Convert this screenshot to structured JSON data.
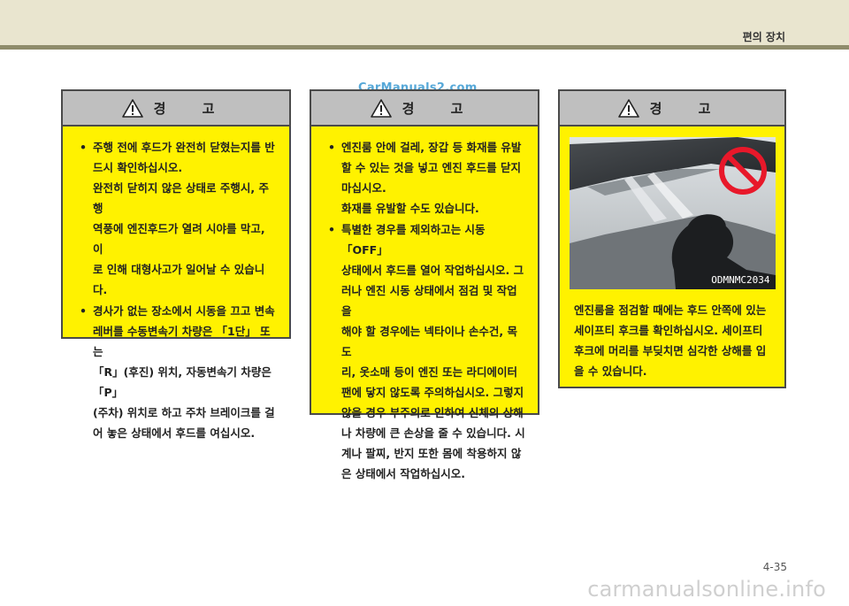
{
  "header": {
    "section_title": "편의 장치"
  },
  "watermark_top": "CarManuals2.com",
  "boxes": [
    {
      "title": "경 고",
      "bullets": [
        {
          "lines": [
            "주행 전에 후드가 완전히 닫혔는지를 반",
            "드시 확인하십시오.",
            "완전히 닫히지 않은 상태로 주행시, 주행",
            "역풍에 엔진후드가 열려 시야를 막고, 이",
            "로 인해 대형사고가 일어날 수 있습니다."
          ]
        },
        {
          "lines": [
            "경사가 없는 장소에서 시동을 끄고 변속",
            "레버를 수동변속기 차량은 「1단」 또는",
            "「R」(후진) 위치, 자동변속기 차량은 「P」",
            "(주차) 위치로 하고 주차 브레이크를 걸",
            "어 놓은 상태에서 후드를 여십시오."
          ]
        }
      ]
    },
    {
      "title": "경 고",
      "bullets": [
        {
          "lines": [
            "엔진룸 안에 걸레, 장갑 등 화재를 유발",
            "할 수 있는 것을 넣고 엔진 후드를 닫지",
            "마십시오.",
            "화재를 유발할 수도 있습니다."
          ]
        },
        {
          "lines": [
            "특별한 경우를 제외하고는 시동 「OFF」",
            "상태에서 후드를 열어 작업하십시오. 그",
            "러나 엔진 시동 상태에서 점검 및 작업을",
            "해야 할 경우에는 넥타이나 손수건, 목도",
            "리, 옷소매 등이 엔진 또는 라디에이터",
            "팬에 닿지 않도록 주의하십시오. 그렇지",
            "않을 경우 부주의로 인하여 신체의 상해",
            "나 차량에 큰 손상을 줄 수 있습니다. 시",
            "계나 팔찌, 반지 또한 몸에 착용하지 않",
            "은 상태에서 작업하십시오."
          ]
        }
      ]
    },
    {
      "title": "경 고",
      "image_code": "ODMNMC2034",
      "caption_lines": [
        "엔진룸을 점검할 때에는 후드 안쪽에 있는",
        "세이프티 후크를 확인하십시오. 세이프티",
        "후크에 머리를 부딪치면 심각한 상해를 입",
        "을 수 있습니다."
      ]
    }
  ],
  "page_number": "4-35",
  "watermark_bottom": "carmanualsonline.info",
  "colors": {
    "warning_yellow": "#fff200",
    "header_gray": "#bfbfbf",
    "band": "#e9e5cf",
    "rule": "#8f8c6b"
  },
  "icons": {
    "warning": "warning-triangle-icon",
    "prohibition": "prohibition-icon"
  }
}
